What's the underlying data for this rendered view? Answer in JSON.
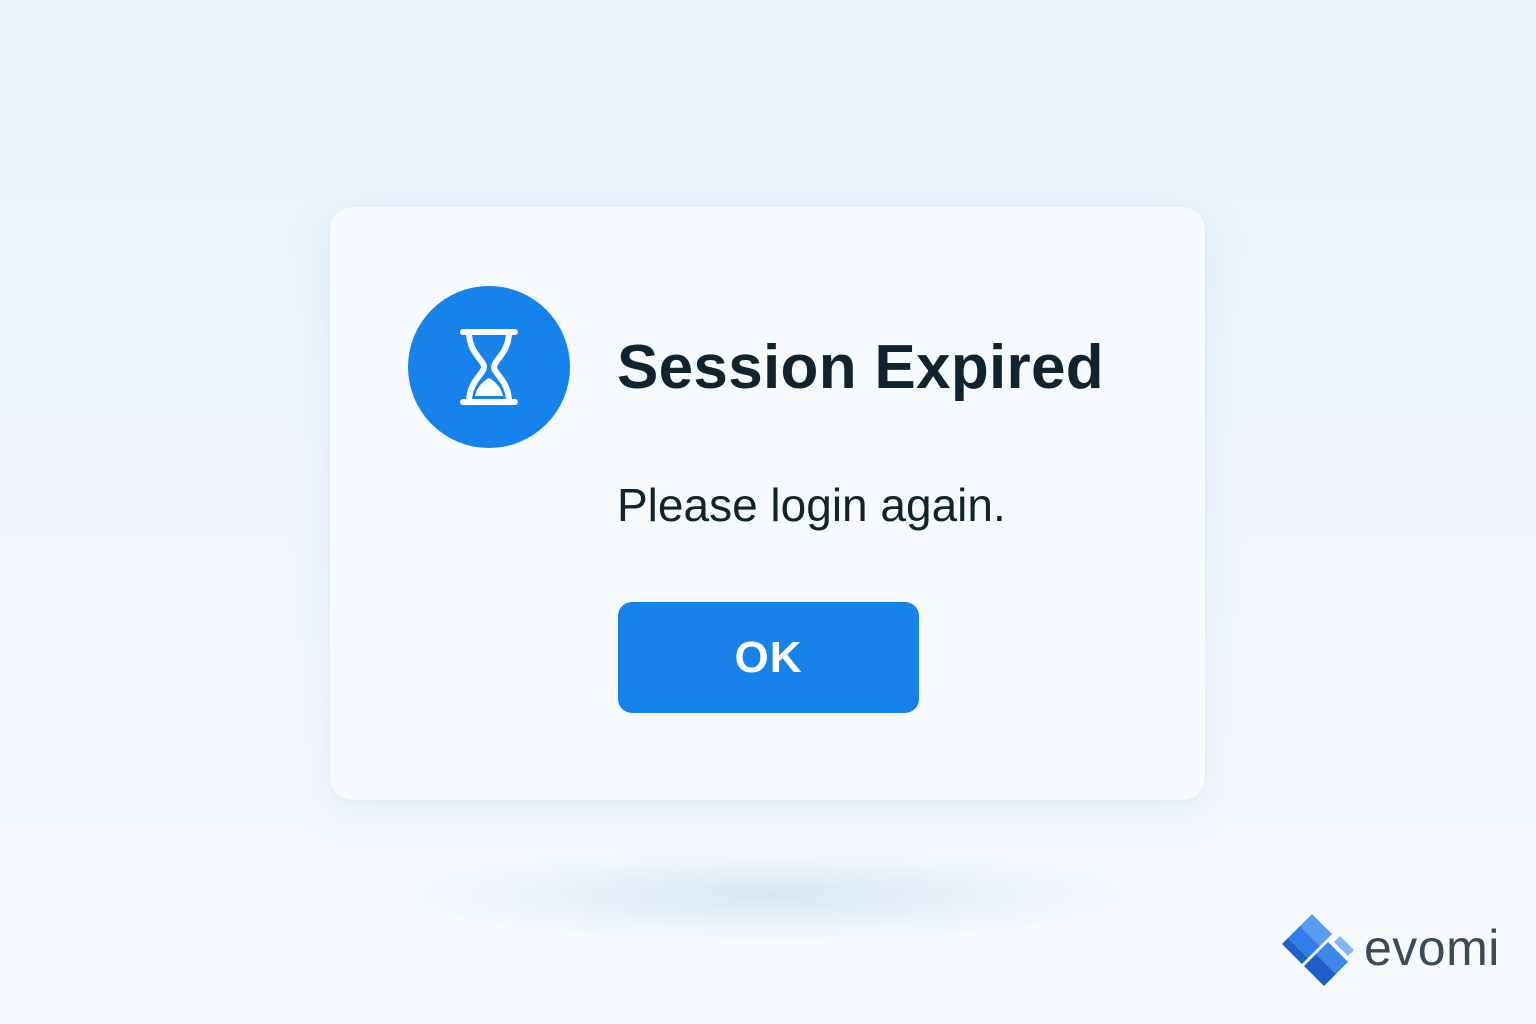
{
  "dialog": {
    "icon": "hourglass-icon",
    "title": "Session Expired",
    "message": "Please login again.",
    "ok_label": "OK"
  },
  "brand": {
    "logo_icon": "evomi-logo-icon",
    "name": "evomi"
  },
  "colors": {
    "accent": "#1682ec",
    "text": "#10232f",
    "dialog_background": "#f7fbfd",
    "page_background": "#eaf4fc",
    "brand_text": "#3d4a57"
  }
}
